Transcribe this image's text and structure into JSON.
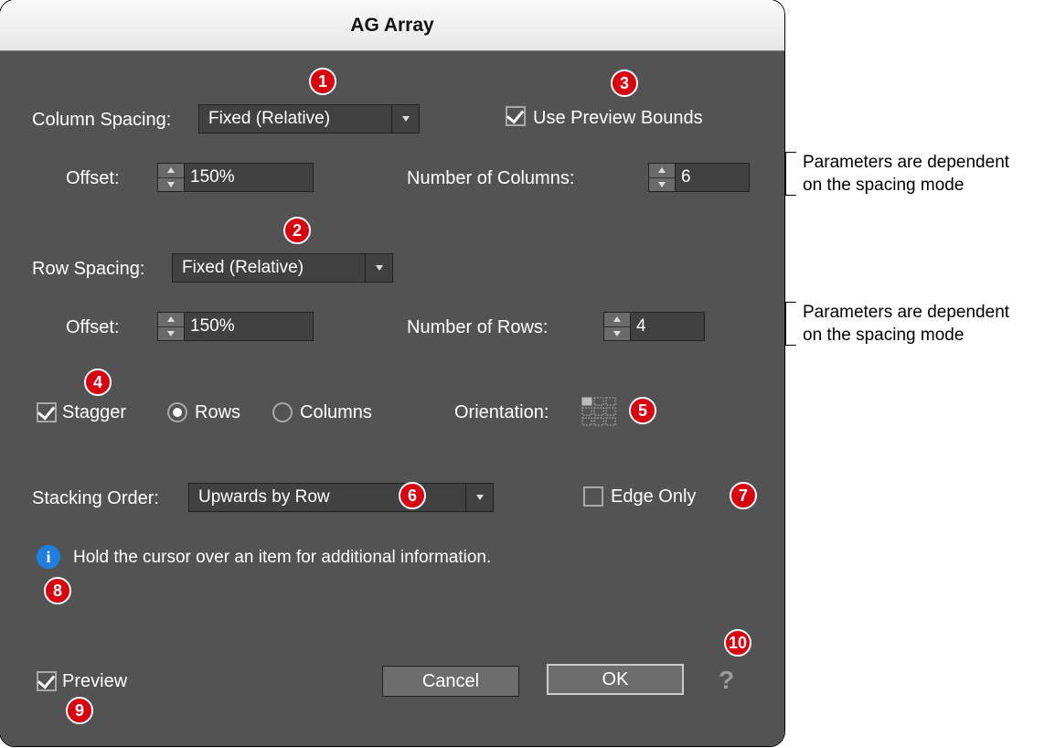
{
  "title": "AG Array",
  "col_spacing": {
    "label": "Column Spacing:",
    "value": "Fixed (Relative)"
  },
  "use_preview_bounds": {
    "label": "Use Preview Bounds",
    "checked": true
  },
  "col_offset": {
    "label": "Offset:",
    "value": "150%"
  },
  "num_cols": {
    "label": "Number of Columns:",
    "value": "6"
  },
  "row_spacing": {
    "label": "Row Spacing:",
    "value": "Fixed (Relative)"
  },
  "row_offset": {
    "label": "Offset:",
    "value": "150%"
  },
  "num_rows": {
    "label": "Number of Rows:",
    "value": "4"
  },
  "stagger": {
    "label": "Stagger",
    "checked": true
  },
  "stagger_rows": {
    "label": "Rows",
    "selected": true
  },
  "stagger_cols": {
    "label": "Columns",
    "selected": false
  },
  "orientation_label": "Orientation:",
  "stacking": {
    "label": "Stacking Order:",
    "value": "Upwards by Row"
  },
  "edge_only": {
    "label": "Edge Only",
    "checked": false
  },
  "info_text": "Hold the cursor over an item for additional information.",
  "preview": {
    "label": "Preview",
    "checked": true
  },
  "cancel_label": "Cancel",
  "ok_label": "OK",
  "note1": "Parameters are dependent on the spacing mode",
  "note2": "Parameters are dependent on the spacing mode",
  "markers": [
    "1",
    "2",
    "3",
    "4",
    "5",
    "6",
    "7",
    "8",
    "9",
    "10"
  ]
}
